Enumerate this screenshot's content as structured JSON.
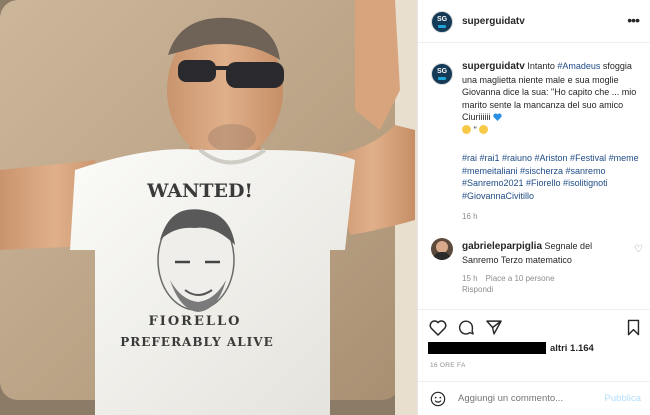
{
  "post": {
    "username": "superguidatv",
    "avatar_text": "SG",
    "more_icon": "more-horizontal-icon"
  },
  "photo": {
    "shirt_line1": "WANTED!",
    "shirt_line2": "FIORELLO",
    "shirt_line3": "PREFERABLY ALIVE"
  },
  "caption": {
    "username": "superguidatv",
    "text_before_tag": "Intanto ",
    "tag": "#Amadeus",
    "text_after_tag": " sfoggia una maglietta niente male e sua moglie Giovanna dice la sua: \"Ho capito che ... mio marito sente la mancanza del suo amico Ciuriiiiii ",
    "text_tail": " \"",
    "emojis": [
      "blue-heart",
      "grinning-sweat-face",
      "grinning-sweat-face"
    ],
    "hashtags": "#rai #rai1 #raiuno #Ariston #Festival #meme #memeitaliani #sischerza #sanremo #Sanremo2021 #Fiorello #isolitignoti #GiovannaCivitillo",
    "time": "16 h"
  },
  "comment": {
    "username": "gabrieleparpiglia",
    "text": " Segnale del Sanremo Terzo matematico",
    "time": "15 h",
    "likes": "Piace a 10 persone",
    "reply": "Rispondi"
  },
  "actions": {
    "likes_suffix": "altri 1.164",
    "time_ago": "16 ORE FA"
  },
  "add_comment": {
    "placeholder": "Aggiungi un commento...",
    "post_label": "Pubblica"
  },
  "colors": {
    "link": "#1f4c86",
    "muted": "#8e8e8e",
    "post_disabled": "#b2dffc"
  }
}
